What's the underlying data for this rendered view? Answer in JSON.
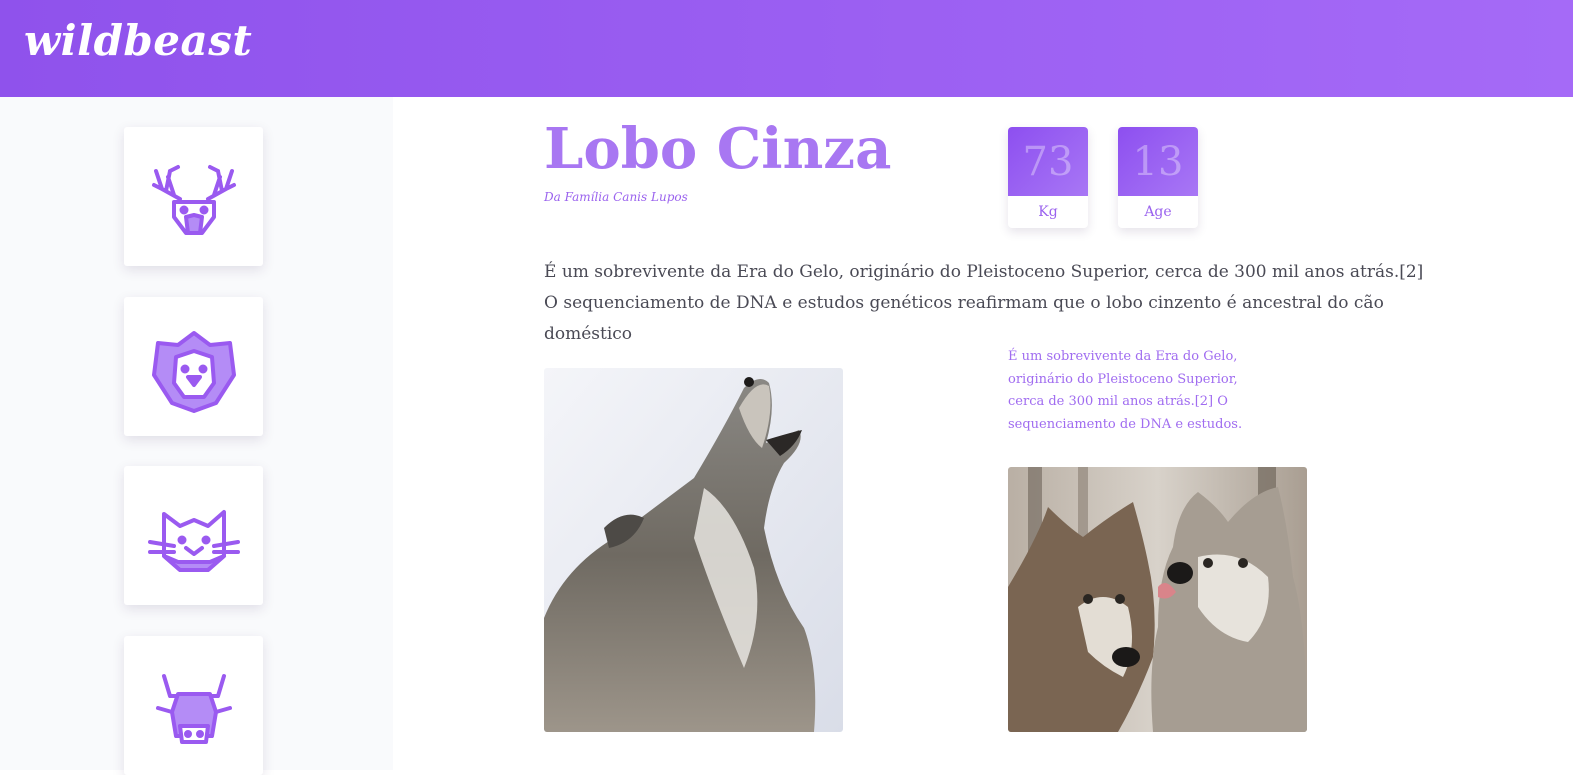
{
  "header": {
    "logo": "wildbeast",
    "logo_color": "#ffffff",
    "gradient": [
      "#8f52ec",
      "#a56af7"
    ]
  },
  "sidebar": {
    "items": [
      {
        "icon": "deer-icon"
      },
      {
        "icon": "lion-icon"
      },
      {
        "icon": "cat-icon"
      },
      {
        "icon": "bull-icon"
      }
    ]
  },
  "animal": {
    "name": "Lobo Cinza",
    "family": "Da Família Canis Lupos",
    "stats": [
      {
        "value": "73",
        "label": "Kg"
      },
      {
        "value": "13",
        "label": "Age"
      }
    ],
    "description": "É um sobrevivente da Era do Gelo, originário do Pleistoceno Superior, cerca de 300 mil anos atrás.[2] O sequenciamento de DNA e estudos genéticos reafirmam que o lobo cinzento é ancestral do cão doméstico",
    "note": "É um sobrevivente da Era do Gelo, originário do Pleistoceno Superior, cerca de 300 mil anos atrás.[2] O sequenciamento de DNA e estudos.",
    "photos": [
      {
        "subject": "howling gray wolf"
      },
      {
        "subject": "two wolves nuzzling"
      }
    ]
  },
  "colors": {
    "accent": "#a877f2",
    "accent_dark": "#8d4ff0",
    "sidebar_bg": "#f9fafc",
    "text": "#4a4a55"
  }
}
